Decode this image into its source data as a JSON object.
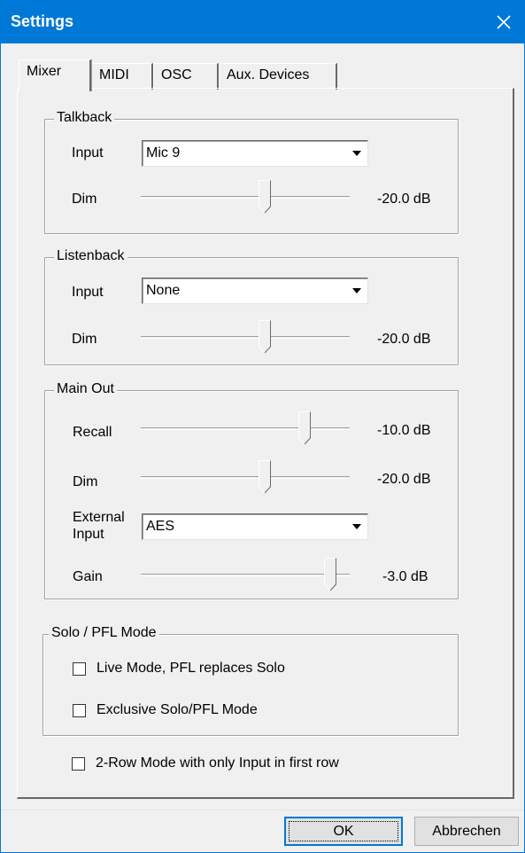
{
  "window": {
    "title": "Settings"
  },
  "tabs": [
    "Mixer",
    "MIDI",
    "OSC",
    "Aux. Devices"
  ],
  "talkback": {
    "label": "Talkback",
    "input_label": "Input",
    "input_value": "Mic 9",
    "dim_label": "Dim",
    "dim_value": "-20.0 dB"
  },
  "listenback": {
    "label": "Listenback",
    "input_label": "Input",
    "input_value": "None",
    "dim_label": "Dim",
    "dim_value": "-20.0 dB"
  },
  "main_out": {
    "label": "Main Out",
    "recall_label": "Recall",
    "recall_value": "-10.0 dB",
    "dim_label": "Dim",
    "dim_value": "-20.0 dB",
    "external_input_label_1": "External",
    "external_input_label_2": "Input",
    "external_input_value": "AES",
    "gain_label": "Gain",
    "gain_value": "-3.0 dB"
  },
  "solo_pfl": {
    "label": "Solo / PFL Mode",
    "live_mode_label": "Live Mode,  PFL replaces Solo",
    "live_mode_checked": false,
    "exclusive_label": "Exclusive Solo/PFL Mode",
    "exclusive_checked": false
  },
  "two_row": {
    "label": "2-Row Mode with only Input in first row",
    "checked": false
  },
  "buttons": {
    "ok": "OK",
    "cancel": "Abbrechen"
  },
  "icons": {
    "close": "close-icon",
    "dropdown": "chevron-down-icon"
  },
  "colors": {
    "titlebar": "#0078d7",
    "background": "#f0f0f0"
  }
}
